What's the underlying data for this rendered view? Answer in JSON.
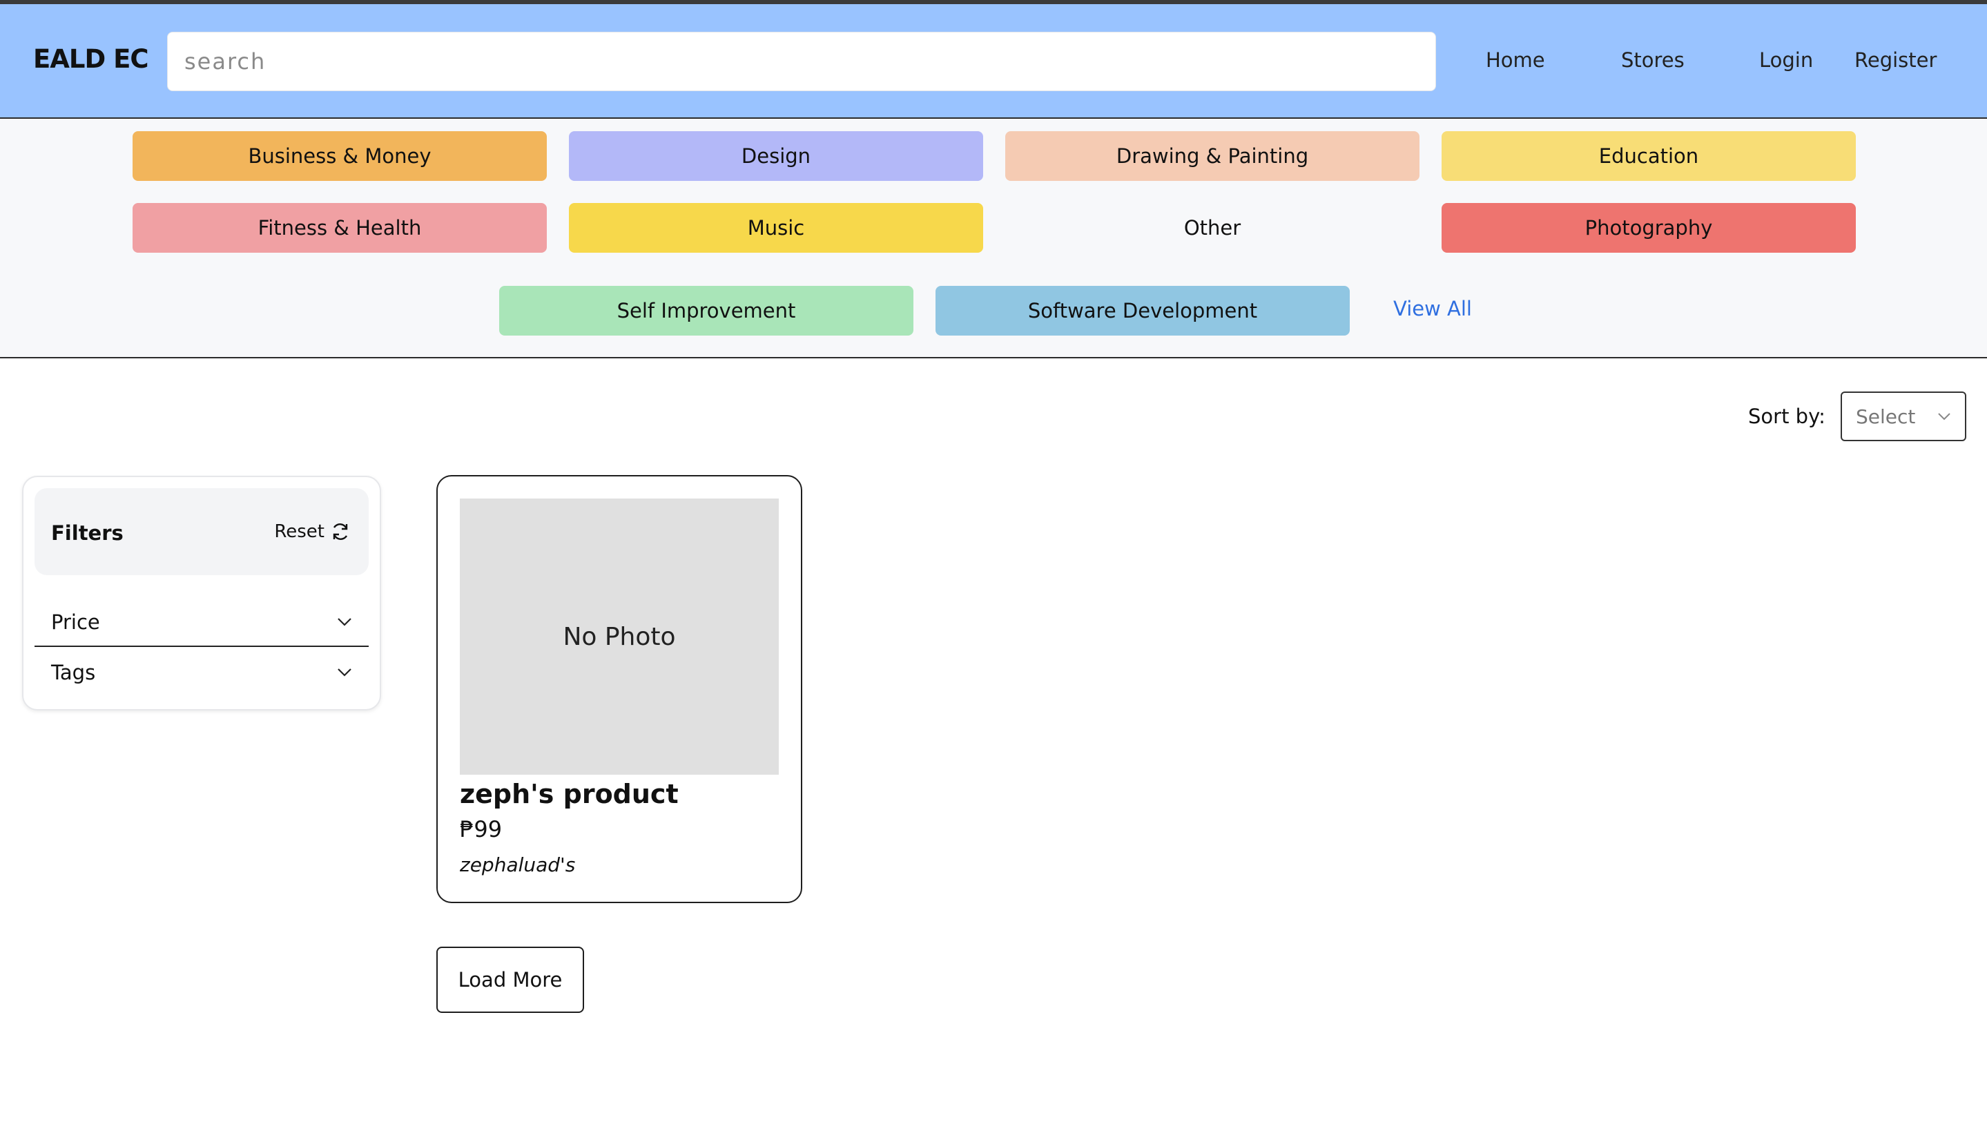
{
  "header": {
    "logo": "EALD EC",
    "search_placeholder": "search",
    "nav": [
      "Home",
      "Stores",
      "Login",
      "Register"
    ]
  },
  "categories": {
    "items": [
      {
        "label": "Business & Money",
        "color": "#f2b55b"
      },
      {
        "label": "Design",
        "color": "#b3b8f8"
      },
      {
        "label": "Drawing & Painting",
        "color": "#f5cbb3"
      },
      {
        "label": "Education",
        "color": "#f8dd76"
      },
      {
        "label": "Fitness & Health",
        "color": "#f0a0a3"
      },
      {
        "label": "Music",
        "color": "#f7d84b"
      },
      {
        "label": "Other",
        "color": "#f7f8fa"
      },
      {
        "label": "Photography",
        "color": "#ee746f"
      },
      {
        "label": "Self Improvement",
        "color": "#a9e5b8"
      },
      {
        "label": "Software Development",
        "color": "#90c6e2"
      }
    ],
    "view_all": "View All"
  },
  "sort": {
    "label": "Sort by:",
    "selected": "Select"
  },
  "filters": {
    "title": "Filters",
    "reset": "Reset",
    "facets": [
      "Price",
      "Tags"
    ]
  },
  "products": [
    {
      "photo_text": "No Photo",
      "name": "zeph's product",
      "price": "₱99",
      "store": "zephaluad's"
    }
  ],
  "load_more": "Load More"
}
